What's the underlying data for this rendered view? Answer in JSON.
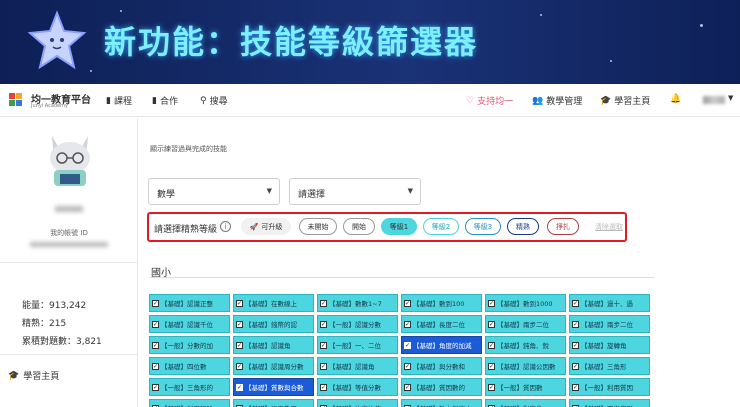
{
  "banner": {
    "title": "新功能：技能等級篩選器"
  },
  "nav": {
    "logo_text": "均一教育平台",
    "logo_sub": "Junyi Academy",
    "courses": "課程",
    "cooperate": "合作",
    "search": "搜尋",
    "support": "支持均一",
    "teach": "教學管理",
    "learn": "學習主頁"
  },
  "sidebar": {
    "id_label": "我的帳號 ID",
    "energy": "能量：913,242",
    "proficient": "精熟：215",
    "total": "累積對題數：3,821",
    "learn_home": "學習主頁"
  },
  "main": {
    "description": "顯示練習過與完成的技能",
    "subject": "數學",
    "grade_placeholder": "請選擇",
    "filter_label": "請選擇精熟等級",
    "chips": [
      "可升級",
      "未開始",
      "開始",
      "等級1",
      "等級2",
      "等級3",
      "精熟",
      "掙扎"
    ],
    "clear": "清除選取",
    "section": "國小"
  },
  "colors": {
    "cell": "#4dd6df",
    "selected": "#1b5bd6",
    "filter_border": "#e01b24"
  },
  "grid": [
    [
      "【基礎】認識正整",
      "【基礎】在數線上",
      "【基礎】數數1~7",
      "【基礎】數到100",
      "【基礎】數到1000",
      "【基礎】過十、過"
    ],
    [
      "【基礎】認識千位",
      "【基礎】錢幣的認",
      "【一般】認識分數",
      "【基礎】長度二位",
      "【基礎】兩步二位",
      "【基礎】兩步二位"
    ],
    [
      "【一般】分數的加",
      "【基礎】認識角",
      "【一般】一、二位",
      "【基礎】角度的加減",
      "【基礎】鈍角、銳",
      "【基礎】旋轉角"
    ],
    [
      "【基礎】四位數",
      "【基礎】認識周分數",
      "【基礎】認識角",
      "【基礎】與分數和",
      "【基礎】認識公因數",
      "【基礎】三角形"
    ],
    [
      "【一般】三角形的",
      "【基礎】質數與合數",
      "【基礎】等值分數",
      "【基礎】質因數的",
      "【一般】質因數",
      "【一般】利用質因"
    ],
    [
      "【基礎】利用短除",
      "【基礎】底面為平",
      "【基礎】比與比值",
      "【基礎】放大與縮小",
      "【基礎】對應角、",
      "【基礎】圓與扇形"
    ]
  ]
}
